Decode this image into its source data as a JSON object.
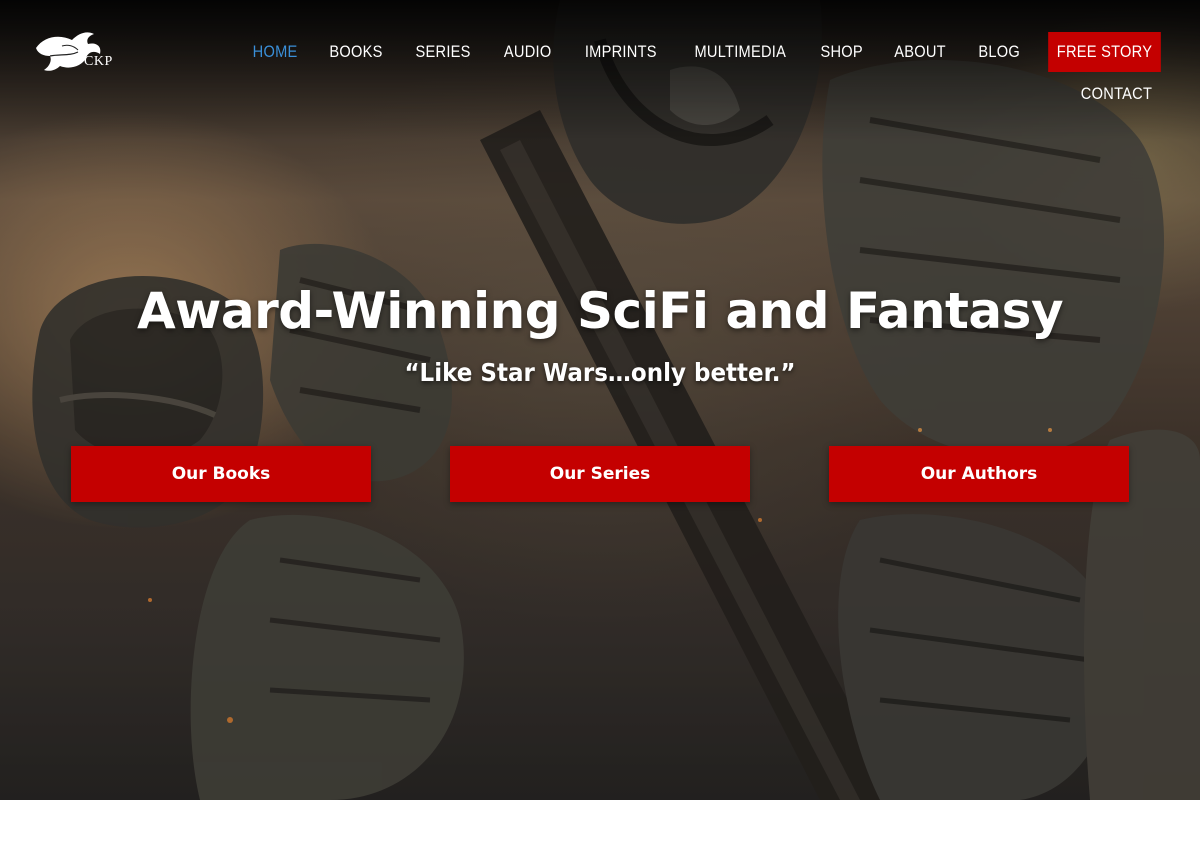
{
  "brand": {
    "logo_text": "CKP",
    "logo_icon": "griffin-icon"
  },
  "nav": {
    "items": [
      {
        "label": "HOME",
        "active": true
      },
      {
        "label": "BOOKS"
      },
      {
        "label": "SERIES"
      },
      {
        "label": "AUDIO"
      },
      {
        "label": "IMPRINTS"
      },
      {
        "label": "MULTIMEDIA"
      },
      {
        "label": "SHOP"
      },
      {
        "label": "ABOUT"
      },
      {
        "label": "BLOG"
      },
      {
        "label": "FREE STORY",
        "highlight": true
      },
      {
        "label": "CONTACT"
      }
    ]
  },
  "hero": {
    "headline": "Award-Winning SciFi and Fantasy",
    "tagline": "“Like Star Wars…only better.”",
    "buttons": [
      {
        "label": "Our Books"
      },
      {
        "label": "Our Series"
      },
      {
        "label": "Our Authors"
      }
    ]
  },
  "colors": {
    "accent_red": "#c40000",
    "active_link": "#3a8fd8",
    "text": "#ffffff"
  }
}
